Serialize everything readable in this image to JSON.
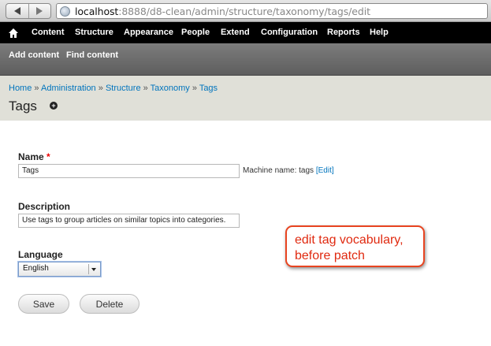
{
  "browser": {
    "url_host": "localhost",
    "url_rest": ":8888/d8-clean/admin/structure/taxonomy/tags/edit"
  },
  "toolbar": {
    "items": [
      "Content",
      "Structure",
      "Appearance",
      "People",
      "Extend",
      "Configuration",
      "Reports",
      "Help"
    ]
  },
  "shortcuts": {
    "items": [
      "Add content",
      "Find content"
    ]
  },
  "breadcrumb": {
    "items": [
      "Home",
      "Administration",
      "Structure",
      "Taxonomy",
      "Tags"
    ],
    "separator": "»"
  },
  "page": {
    "title": "Tags",
    "add_shortcut_symbol": "+"
  },
  "form": {
    "name_label": "Name",
    "required_mark": "*",
    "name_value": "Tags",
    "machine_name_text": "Machine name: tags",
    "machine_edit_link": "[Edit]",
    "description_label": "Description",
    "description_value": "Use tags to group articles on similar topics into categories.",
    "language_label": "Language",
    "language_value": "English",
    "save_label": "Save",
    "delete_label": "Delete"
  },
  "annotation": {
    "line1": "edit tag vocabulary,",
    "line2": "before patch"
  },
  "colors": {
    "link": "#0074bd",
    "toolbar_bg": "#000000",
    "header_bg": "#e0e0d8",
    "callout_border": "#e84420"
  }
}
